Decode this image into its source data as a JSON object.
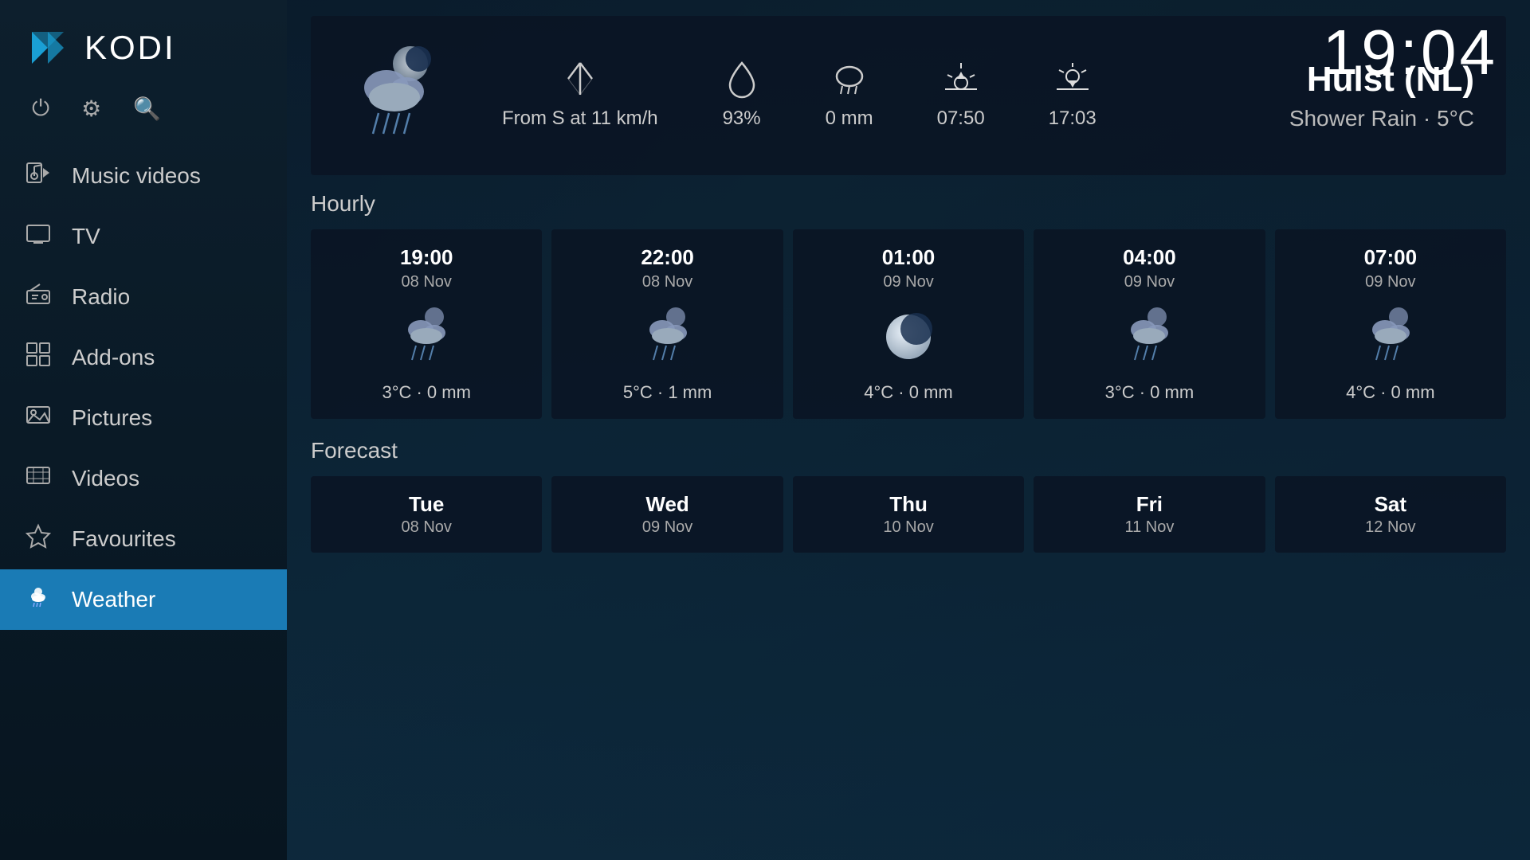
{
  "app": {
    "name": "KODI",
    "time": "19:04"
  },
  "sidebar": {
    "items": [
      {
        "id": "music-videos",
        "label": "Music videos",
        "icon": "🎬"
      },
      {
        "id": "tv",
        "label": "TV",
        "icon": "📺"
      },
      {
        "id": "radio",
        "label": "Radio",
        "icon": "📻"
      },
      {
        "id": "add-ons",
        "label": "Add-ons",
        "icon": "📦"
      },
      {
        "id": "pictures",
        "label": "Pictures",
        "icon": "🖼"
      },
      {
        "id": "videos",
        "label": "Videos",
        "icon": "🎞"
      },
      {
        "id": "favourites",
        "label": "Favourites",
        "icon": "⭐"
      },
      {
        "id": "weather",
        "label": "Weather",
        "icon": "🌦",
        "active": true
      }
    ]
  },
  "weather": {
    "location": "Hulst (NL)",
    "condition": "Shower Rain · 5°C",
    "wind": "From S at 11 km/h",
    "humidity": "93%",
    "precipitation": "0 mm",
    "sunrise": "07:50",
    "sunset": "17:03",
    "hourly_label": "Hourly",
    "forecast_label": "Forecast",
    "hourly": [
      {
        "time": "19:00",
        "date": "08 Nov",
        "temp": "3°C · 0 mm"
      },
      {
        "time": "22:00",
        "date": "08 Nov",
        "temp": "5°C · 1 mm"
      },
      {
        "time": "01:00",
        "date": "09 Nov",
        "temp": "4°C · 0 mm"
      },
      {
        "time": "04:00",
        "date": "09 Nov",
        "temp": "3°C · 0 mm"
      },
      {
        "time": "07:00",
        "date": "09 Nov",
        "temp": "4°C · 0 mm"
      }
    ],
    "forecast": [
      {
        "day": "Tue",
        "date": "08 Nov"
      },
      {
        "day": "Wed",
        "date": "09 Nov"
      },
      {
        "day": "Thu",
        "date": "10 Nov"
      },
      {
        "day": "Fri",
        "date": "11 Nov"
      },
      {
        "day": "Sat",
        "date": "12 Nov"
      }
    ]
  }
}
